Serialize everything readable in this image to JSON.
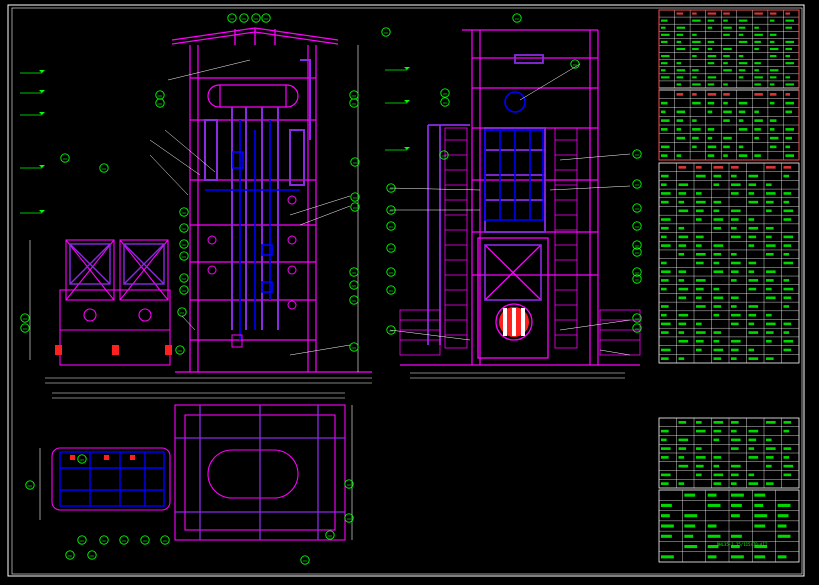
{
  "drawing": {
    "background": "#000000",
    "colors": {
      "frame": "#ffffff",
      "structure": "#ff00ff",
      "ducts": "#8a2be2",
      "piping": "#0000ff",
      "annotation": "#00ff00",
      "dimension": "#ffffff",
      "table_line": "#ffffff",
      "table_text": "#00ff00",
      "accent_red": "#ff2020",
      "table_header": "#ff4040"
    },
    "views": [
      {
        "name": "front-elevation-view"
      },
      {
        "name": "side-elevation-view"
      },
      {
        "name": "plan-view"
      }
    ],
    "tables": {
      "parameter_table": {
        "rows": 11,
        "cols": 9
      },
      "materials_list": {
        "rows": 23,
        "cols": 8
      },
      "revision_table": {
        "rows": 8,
        "cols": 8
      },
      "title_block": {
        "rows": 7,
        "cols": 6
      }
    },
    "title_block": {
      "drawing_number": "DHL35-1.25/115/70-AII",
      "note": ""
    }
  }
}
